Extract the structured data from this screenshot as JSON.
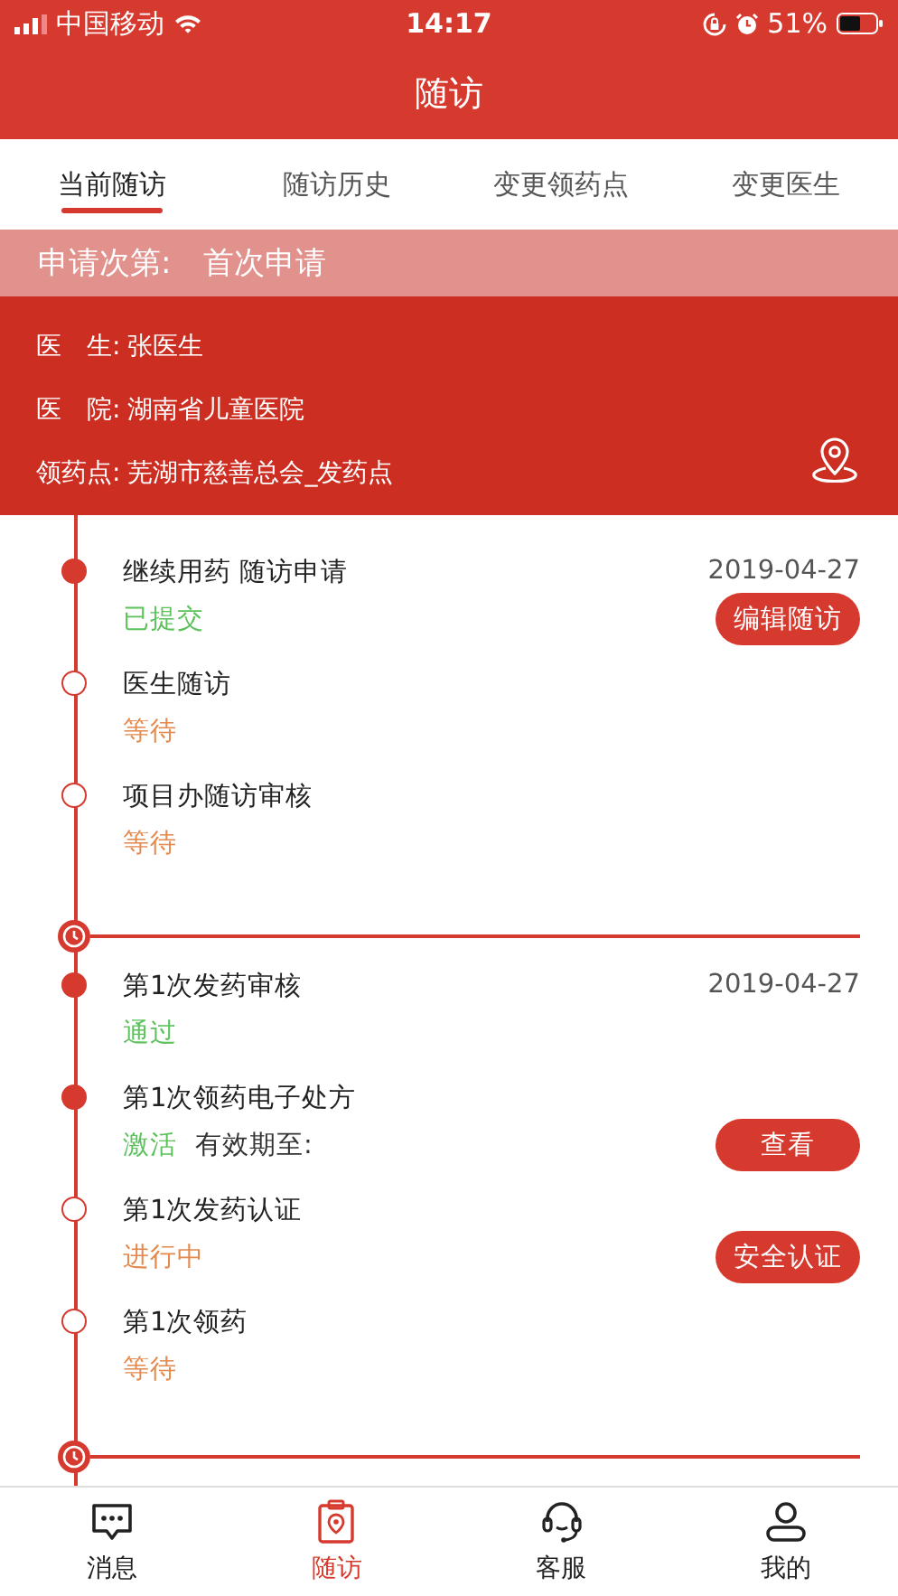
{
  "status_bar": {
    "carrier": "中国移动",
    "time": "14:17",
    "battery_percent": "51%"
  },
  "header": {
    "title": "随访"
  },
  "tabs": [
    {
      "label": "当前随访",
      "selected": true
    },
    {
      "label": "随访历史",
      "selected": false
    },
    {
      "label": "变更领药点",
      "selected": false
    },
    {
      "label": "变更医生",
      "selected": false
    }
  ],
  "application": {
    "label": "申请次第:",
    "value": "首次申请"
  },
  "info": [
    {
      "label": "医　生:",
      "value": "张医生"
    },
    {
      "label": "医　院:",
      "value": "湖南省儿童医院"
    },
    {
      "label": "领药点:",
      "value": "芜湖市慈善总会_发药点"
    }
  ],
  "timeline": [
    {
      "steps": [
        {
          "title": "继续用药 随访申请",
          "done": true,
          "status": "已提交",
          "kind": "success",
          "date": "2019-04-27",
          "button": "编辑随访"
        },
        {
          "title": "医生随访",
          "done": false,
          "status": "等待",
          "kind": "waiting"
        },
        {
          "title": "项目办随访审核",
          "done": false,
          "status": "等待",
          "kind": "waiting"
        }
      ]
    },
    {
      "steps": [
        {
          "title": "第1次发药审核",
          "done": true,
          "status": "通过",
          "kind": "success",
          "date": "2019-04-27"
        },
        {
          "title": "第1次领药电子处方",
          "done": true,
          "status": "激活",
          "kind": "success",
          "note": "有效期至:",
          "button": "查看"
        },
        {
          "title": "第1次发药认证",
          "done": false,
          "status": "进行中",
          "kind": "waiting",
          "button": "安全认证"
        },
        {
          "title": "第1次领药",
          "done": false,
          "status": "等待",
          "kind": "waiting"
        }
      ]
    }
  ],
  "bottom_nav": [
    {
      "label": "消息",
      "selected": false
    },
    {
      "label": "随访",
      "selected": true
    },
    {
      "label": "客服",
      "selected": false
    },
    {
      "label": "我的",
      "selected": false
    }
  ]
}
